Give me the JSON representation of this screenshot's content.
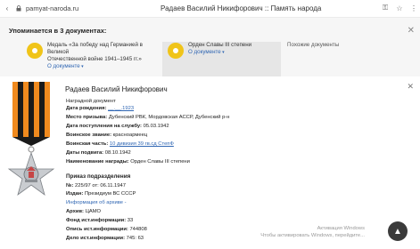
{
  "browser": {
    "url": "pamyat-naroda.ru",
    "title": "Радаев Василий Никифорович :: Память народа"
  },
  "mentions": {
    "title": "Упоминается в 3 документах:",
    "cards": [
      {
        "line1": "Медаль «За победу над Германией в Великой",
        "line2": "Отечественной войне 1941–1945 гг.»",
        "link": "О документе"
      },
      {
        "line1": "Орден Славы III степени",
        "link": "О документе"
      },
      {
        "line1": "Похожие документы"
      }
    ]
  },
  "person": {
    "name": "Радаев Василий Никифорович",
    "doc_type": "Наградной документ",
    "fields": [
      {
        "label": "Дата рождения:",
        "value": "__.__.1923",
        "link": true
      },
      {
        "label": "Место призыва:",
        "value": "Дубенский РВК, Мордовская АССР, Дубенский р-н"
      },
      {
        "label": "Дата поступления на службу:",
        "value": "05.03.1942"
      },
      {
        "label": "Воинское звание:",
        "value": "красноармеец"
      },
      {
        "label": "Воинская часть:",
        "value": "10 дивизия 39 гв.сд СтепФ",
        "link": true
      },
      {
        "label": "Даты подвига:",
        "value": "08.10.1942"
      },
      {
        "label": "Наименование награды:",
        "value": "Орден Славы III степени"
      }
    ]
  },
  "order": {
    "title": "Приказ подразделения",
    "fields": [
      {
        "label": "№:",
        "value": "225/97 от: 06.11.1947"
      },
      {
        "label": "Издан:",
        "value": "Президиум ВС СССР"
      },
      {
        "label": "",
        "value": "Информация об архиве",
        "link": true
      },
      {
        "label": "Архив:",
        "value": "ЦАМО"
      },
      {
        "label": "Фонд ист.информации:",
        "value": "33"
      },
      {
        "label": "Опись ист.информации:",
        "value": "744808"
      },
      {
        "label": "Дело ист.информации:",
        "value": "745: 63"
      }
    ]
  },
  "watermark": {
    "line1": "Активация Windows",
    "line2": "Чтобы активировать Windows, перейдите..."
  }
}
